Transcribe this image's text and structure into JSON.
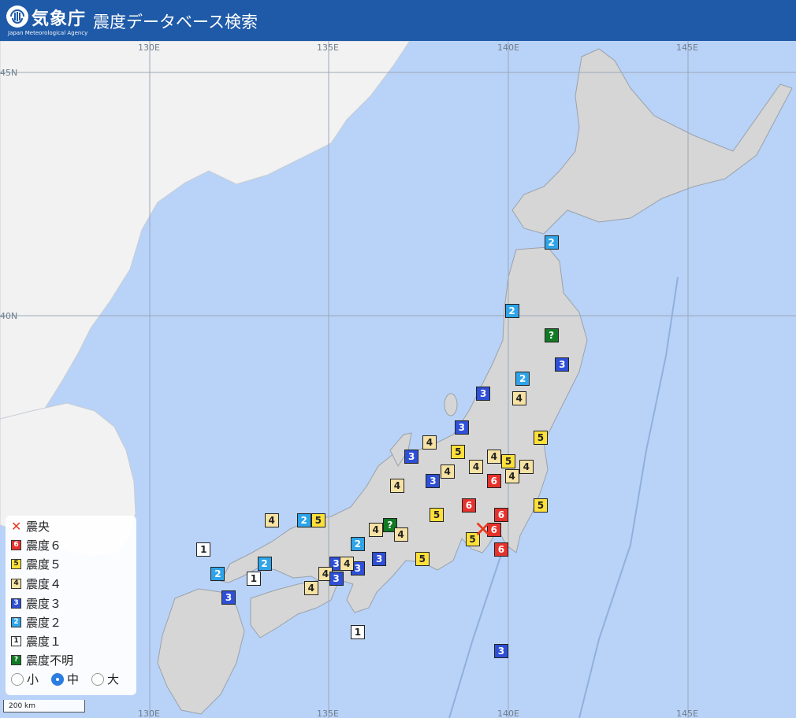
{
  "header": {
    "logo_text": "気象庁",
    "logo_sub": "Japan Meteorological Agency",
    "title": "震度データベース検索"
  },
  "grid_labels": {
    "lon": [
      "130E",
      "135E",
      "140E",
      "145E"
    ],
    "lat": [
      "45N",
      "40N"
    ]
  },
  "markers": [
    {
      "v": "2",
      "lon": 141.2,
      "lat": 41.5
    },
    {
      "v": "2",
      "lon": 140.1,
      "lat": 40.1
    },
    {
      "v": "?",
      "lon": 141.2,
      "lat": 39.6
    },
    {
      "v": "3",
      "lon": 141.5,
      "lat": 39.0
    },
    {
      "v": "2",
      "lon": 140.4,
      "lat": 38.7
    },
    {
      "v": "3",
      "lon": 139.3,
      "lat": 38.4
    },
    {
      "v": "4",
      "lon": 140.3,
      "lat": 38.3
    },
    {
      "v": "3",
      "lon": 138.7,
      "lat": 37.7
    },
    {
      "v": "5",
      "lon": 140.9,
      "lat": 37.5
    },
    {
      "v": "4",
      "lon": 137.8,
      "lat": 37.4
    },
    {
      "v": "3",
      "lon": 137.3,
      "lat": 37.1
    },
    {
      "v": "5",
      "lon": 138.6,
      "lat": 37.2
    },
    {
      "v": "4",
      "lon": 139.6,
      "lat": 37.1
    },
    {
      "v": "5",
      "lon": 140.0,
      "lat": 37.0
    },
    {
      "v": "4",
      "lon": 139.1,
      "lat": 36.9
    },
    {
      "v": "4",
      "lon": 140.5,
      "lat": 36.9
    },
    {
      "v": "4",
      "lon": 138.3,
      "lat": 36.8
    },
    {
      "v": "4",
      "lon": 140.1,
      "lat": 36.7
    },
    {
      "v": "6",
      "lon": 139.6,
      "lat": 36.6
    },
    {
      "v": "3",
      "lon": 137.9,
      "lat": 36.6
    },
    {
      "v": "4",
      "lon": 136.9,
      "lat": 36.5
    },
    {
      "v": "5",
      "lon": 140.9,
      "lat": 36.1
    },
    {
      "v": "6",
      "lon": 138.9,
      "lat": 36.1
    },
    {
      "v": "6",
      "lon": 139.8,
      "lat": 35.9
    },
    {
      "v": "5",
      "lon": 138.0,
      "lat": 35.9
    },
    {
      "v": "4",
      "lon": 133.4,
      "lat": 35.8
    },
    {
      "v": "2",
      "lon": 134.3,
      "lat": 35.8
    },
    {
      "v": "5",
      "lon": 134.7,
      "lat": 35.8
    },
    {
      "v": "?",
      "lon": 136.7,
      "lat": 35.7
    },
    {
      "v": "4",
      "lon": 136.3,
      "lat": 35.6
    },
    {
      "v": "6",
      "lon": 139.6,
      "lat": 35.6
    },
    {
      "v": "4",
      "lon": 137.0,
      "lat": 35.5
    },
    {
      "v": "5",
      "lon": 139.0,
      "lat": 35.4
    },
    {
      "v": "2",
      "lon": 135.8,
      "lat": 35.3
    },
    {
      "v": "6",
      "lon": 139.8,
      "lat": 35.2
    },
    {
      "v": "1",
      "lon": 131.5,
      "lat": 35.2
    },
    {
      "v": "3",
      "lon": 136.4,
      "lat": 35.0
    },
    {
      "v": "5",
      "lon": 137.6,
      "lat": 35.0
    },
    {
      "v": "3",
      "lon": 135.2,
      "lat": 34.9
    },
    {
      "v": "2",
      "lon": 133.2,
      "lat": 34.9
    },
    {
      "v": "3",
      "lon": 135.8,
      "lat": 34.8
    },
    {
      "v": "4",
      "lon": 135.5,
      "lat": 34.9
    },
    {
      "v": "2",
      "lon": 131.9,
      "lat": 34.7
    },
    {
      "v": "4",
      "lon": 134.9,
      "lat": 34.7
    },
    {
      "v": "3",
      "lon": 135.2,
      "lat": 34.6
    },
    {
      "v": "1",
      "lon": 132.9,
      "lat": 34.6
    },
    {
      "v": "4",
      "lon": 134.5,
      "lat": 34.4
    },
    {
      "v": "3",
      "lon": 132.2,
      "lat": 34.2
    },
    {
      "v": "1",
      "lon": 135.8,
      "lat": 33.5
    },
    {
      "v": "3",
      "lon": 139.8,
      "lat": 33.1
    }
  ],
  "epicenter": {
    "lon": 139.3,
    "lat": 35.6
  },
  "legend": {
    "items": [
      {
        "kind": "epicenter",
        "label": "震央"
      },
      {
        "kind": "6",
        "label": "震度６"
      },
      {
        "kind": "5",
        "label": "震度５"
      },
      {
        "kind": "4",
        "label": "震度４"
      },
      {
        "kind": "3",
        "label": "震度３"
      },
      {
        "kind": "2",
        "label": "震度２"
      },
      {
        "kind": "1",
        "label": "震度１"
      },
      {
        "kind": "?",
        "label": "震度不明"
      }
    ],
    "size_options": [
      "小",
      "中",
      "大"
    ],
    "size_selected": "中"
  },
  "scale_label": "200 km",
  "colors": {
    "sea": "#b9d2f7",
    "japan_land": "#d6d6d6",
    "continent_land": "#f2f2f2",
    "int6": "#e6322d",
    "int5": "#fde03a",
    "int4": "#f6e3a4",
    "int3": "#2e4fd6",
    "int2": "#2fa4e8",
    "int1": "#ffffff",
    "unknown": "#127a24"
  }
}
